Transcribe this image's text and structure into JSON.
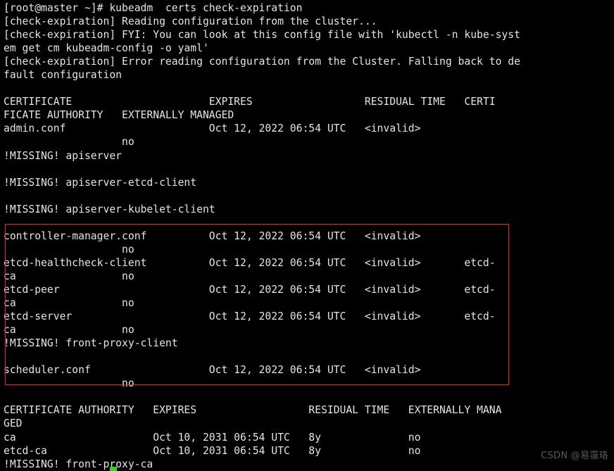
{
  "terminal": {
    "title": "root@master terminal — kubeadm certs check-expiration",
    "background_color": "#000000",
    "foreground_color": "#e4e4e4",
    "cursor_color": "#1ee01e",
    "annotation_color": "#ef2424",
    "prompt": "[root@master ~]#",
    "command": "kubeadm  certs check-expiration",
    "lines": [
      "[root@master ~]# kubeadm  certs check-expiration",
      "[check-expiration] Reading configuration from the cluster...",
      "[check-expiration] FYI: You can look at this config file with 'kubectl -n kube-syst",
      "em get cm kubeadm-config -o yaml'",
      "[check-expiration] Error reading configuration from the Cluster. Falling back to de",
      "fault configuration",
      "",
      "CERTIFICATE                      EXPIRES                  RESIDUAL TIME   CERTI",
      "FICATE AUTHORITY   EXTERNALLY MANAGED",
      "admin.conf                       Oct 12, 2022 06:54 UTC   <invalid>",
      "                   no",
      "!MISSING! apiserver",
      "",
      "!MISSING! apiserver-etcd-client",
      "",
      "!MISSING! apiserver-kubelet-client",
      "",
      "controller-manager.conf          Oct 12, 2022 06:54 UTC   <invalid>",
      "                   no",
      "etcd-healthcheck-client          Oct 12, 2022 06:54 UTC   <invalid>       etcd-",
      "ca                 no",
      "etcd-peer                        Oct 12, 2022 06:54 UTC   <invalid>       etcd-",
      "ca                 no",
      "etcd-server                      Oct 12, 2022 06:54 UTC   <invalid>       etcd-",
      "ca                 no",
      "!MISSING! front-proxy-client",
      "",
      "scheduler.conf                   Oct 12, 2022 06:54 UTC   <invalid>",
      "                   no",
      "",
      "CERTIFICATE AUTHORITY   EXPIRES                  RESIDUAL TIME   EXTERNALLY MANA",
      "GED",
      "ca                      Oct 10, 2031 06:54 UTC   8y              no",
      "etcd-ca                 Oct 10, 2031 06:54 UTC   8y              no",
      "!MISSING! front-proxy-ca"
    ]
  },
  "cert_table": {
    "headers": [
      "CERTIFICATE",
      "EXPIRES",
      "RESIDUAL TIME",
      "CERTIFICATE AUTHORITY",
      "EXTERNALLY MANAGED"
    ],
    "rows": [
      {
        "certificate": "admin.conf",
        "expires": "Oct 12, 2022 06:54 UTC",
        "residual_time": "<invalid>",
        "certificate_authority": "",
        "externally_managed": "no"
      },
      {
        "certificate": "!MISSING! apiserver",
        "expires": "",
        "residual_time": "",
        "certificate_authority": "",
        "externally_managed": ""
      },
      {
        "certificate": "!MISSING! apiserver-etcd-client",
        "expires": "",
        "residual_time": "",
        "certificate_authority": "",
        "externally_managed": ""
      },
      {
        "certificate": "!MISSING! apiserver-kubelet-client",
        "expires": "",
        "residual_time": "",
        "certificate_authority": "",
        "externally_managed": ""
      },
      {
        "certificate": "controller-manager.conf",
        "expires": "Oct 12, 2022 06:54 UTC",
        "residual_time": "<invalid>",
        "certificate_authority": "",
        "externally_managed": "no"
      },
      {
        "certificate": "etcd-healthcheck-client",
        "expires": "Oct 12, 2022 06:54 UTC",
        "residual_time": "<invalid>",
        "certificate_authority": "etcd-ca",
        "externally_managed": "no"
      },
      {
        "certificate": "etcd-peer",
        "expires": "Oct 12, 2022 06:54 UTC",
        "residual_time": "<invalid>",
        "certificate_authority": "etcd-ca",
        "externally_managed": "no"
      },
      {
        "certificate": "etcd-server",
        "expires": "Oct 12, 2022 06:54 UTC",
        "residual_time": "<invalid>",
        "certificate_authority": "etcd-ca",
        "externally_managed": "no"
      },
      {
        "certificate": "!MISSING! front-proxy-client",
        "expires": "",
        "residual_time": "",
        "certificate_authority": "",
        "externally_managed": ""
      },
      {
        "certificate": "scheduler.conf",
        "expires": "Oct 12, 2022 06:54 UTC",
        "residual_time": "<invalid>",
        "certificate_authority": "",
        "externally_managed": "no"
      }
    ]
  },
  "ca_table": {
    "headers": [
      "CERTIFICATE AUTHORITY",
      "EXPIRES",
      "RESIDUAL TIME",
      "EXTERNALLY MANAGED"
    ],
    "rows": [
      {
        "certificate_authority": "ca",
        "expires": "Oct 10, 2031 06:54 UTC",
        "residual_time": "8y",
        "externally_managed": "no"
      },
      {
        "certificate_authority": "etcd-ca",
        "expires": "Oct 10, 2031 06:54 UTC",
        "residual_time": "8y",
        "externally_managed": "no"
      },
      {
        "certificate_authority": "!MISSING! front-proxy-ca",
        "expires": "",
        "residual_time": "",
        "externally_managed": ""
      }
    ]
  },
  "watermark": {
    "text": "CSDN @易霭珞"
  }
}
